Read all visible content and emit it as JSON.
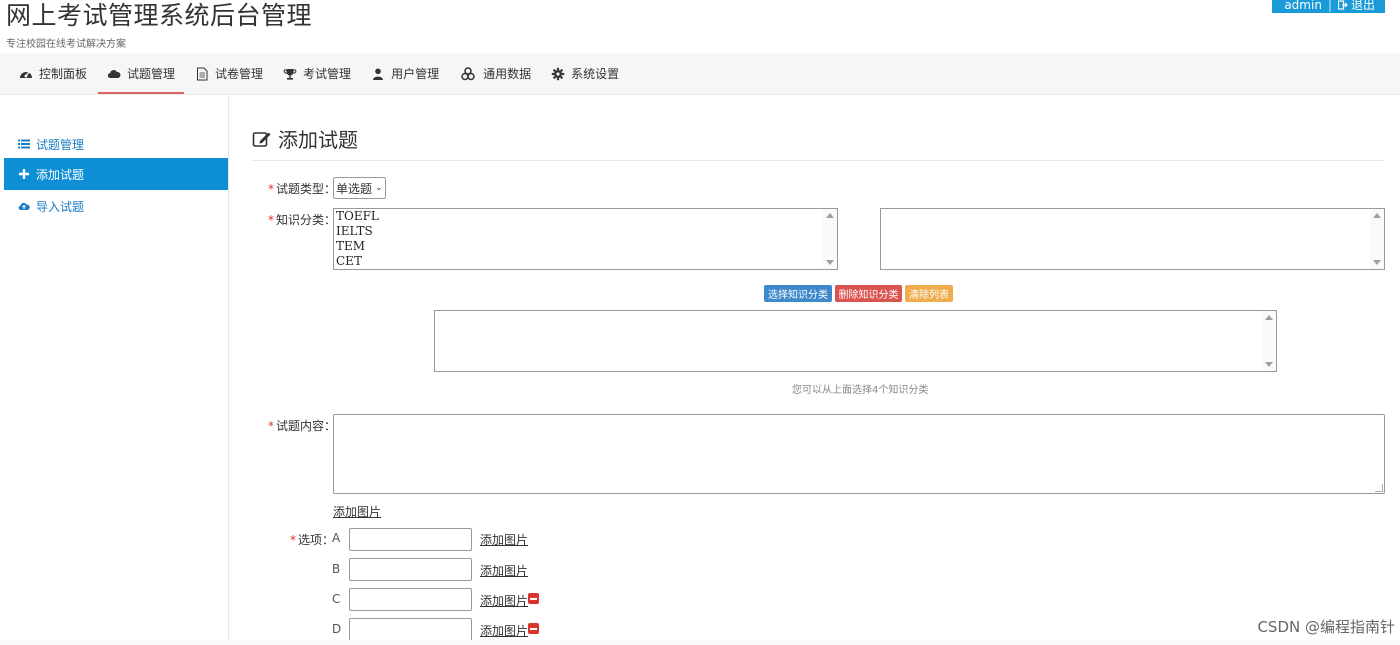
{
  "header": {
    "title": "网上考试管理系统后台管理",
    "subtitle": "专注校园在线考试解决方案",
    "user": "admin",
    "separator": "|",
    "logout": "退出"
  },
  "nav": {
    "items": [
      {
        "label": "控制面板",
        "icon": "dashboard-icon"
      },
      {
        "label": "试题管理",
        "icon": "cloud-icon"
      },
      {
        "label": "试卷管理",
        "icon": "document-icon"
      },
      {
        "label": "考试管理",
        "icon": "trophy-icon"
      },
      {
        "label": "用户管理",
        "icon": "user-icon"
      },
      {
        "label": "通用数据",
        "icon": "cubes-icon"
      },
      {
        "label": "系统设置",
        "icon": "gear-icon"
      }
    ],
    "active": "试题管理"
  },
  "sidebar": {
    "items": [
      {
        "label": "试题管理",
        "icon": "list-icon"
      },
      {
        "label": "添加试题",
        "icon": "plus-icon"
      },
      {
        "label": "导入试题",
        "icon": "cloud-upload-icon"
      }
    ],
    "active": "添加试题"
  },
  "main": {
    "title": "添加试题",
    "form": {
      "type_label": "试题类型：",
      "type_value": "单选题",
      "category_label": "知识分类：",
      "categories": [
        "TOEFL",
        "IELTS",
        "TEM",
        "CET"
      ],
      "buttons": {
        "select": "选择知识分类",
        "delete": "删除知识分类",
        "clear": "清除列表"
      },
      "hint": "您可以从上面选择4个知识分类",
      "content_label": "试题内容：",
      "add_image": "添加图片",
      "options_label": "选项：",
      "options": [
        {
          "letter": "A",
          "value": "",
          "add_image": "添加图片"
        },
        {
          "letter": "B",
          "value": "",
          "add_image": "添加图片"
        },
        {
          "letter": "C",
          "value": "",
          "add_image": "添加图片"
        },
        {
          "letter": "D",
          "value": "",
          "add_image": "添加图片"
        }
      ],
      "required_mark": "*"
    }
  },
  "watermark": "CSDN @编程指南针",
  "colors": {
    "accent": "#0e8ed4",
    "link": "#1a7cc4",
    "danger": "#d9534f",
    "warning": "#f0ad4e",
    "primary_btn": "#3e88cc",
    "nav_active_underline": "#e06565"
  }
}
